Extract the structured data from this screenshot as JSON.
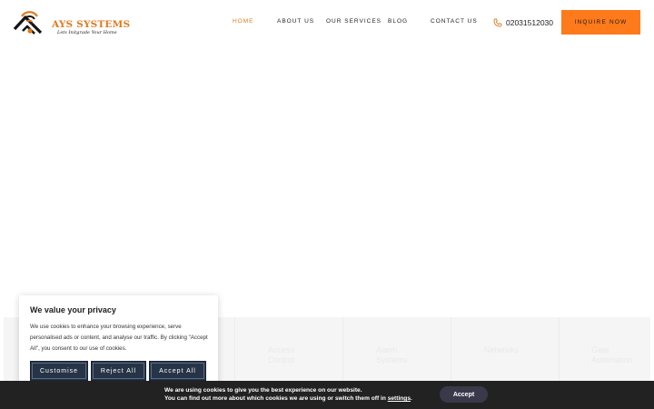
{
  "header": {
    "logo": {
      "name": "AYS SYSTEMS",
      "tagline": "Lets Initgrade Your Home",
      "icon": "house-wifi-logo"
    },
    "nav": [
      {
        "label": "HOME",
        "active": true
      },
      {
        "label": "ABOUT US",
        "active": false
      },
      {
        "label": "OUR SERVICES",
        "active": false
      },
      {
        "label": "BLOG",
        "active": false
      },
      {
        "label": "CONTACT US",
        "active": false
      }
    ],
    "phone": {
      "icon": "phone-icon",
      "number": "02031512030"
    },
    "cta_label": "INQUIRE NOW"
  },
  "colors": {
    "accent": "#ff7a1a",
    "brand_text": "#e07a1f",
    "dark_button": "#263447",
    "cookie_bar": "#222222"
  },
  "feature_strip": {
    "items": [
      {
        "line1": "Access",
        "line2": "Control"
      },
      {
        "line1": "Alarm",
        "line2": "Systems"
      },
      {
        "line1": "Networks",
        "line2": ""
      },
      {
        "line1": "Gate",
        "line2": "Automation"
      }
    ]
  },
  "consent": {
    "title": "We value your privacy",
    "text": "We use cookies to enhance your browsing experience, serve personalised ads or content, and analyse our traffic. By clicking \"Accept All\", you consent to our use of cookies.",
    "buttons": {
      "customise": "Customise",
      "reject": "Reject All",
      "accept": "Accept All"
    }
  },
  "cookie_bar": {
    "line1": "We are using cookies to give you the best experience on our website.",
    "line2_prefix": "You can find out more about which cookies we are using or switch them off in",
    "link": "settings",
    "line2_suffix": ".",
    "accept": "Accept"
  }
}
